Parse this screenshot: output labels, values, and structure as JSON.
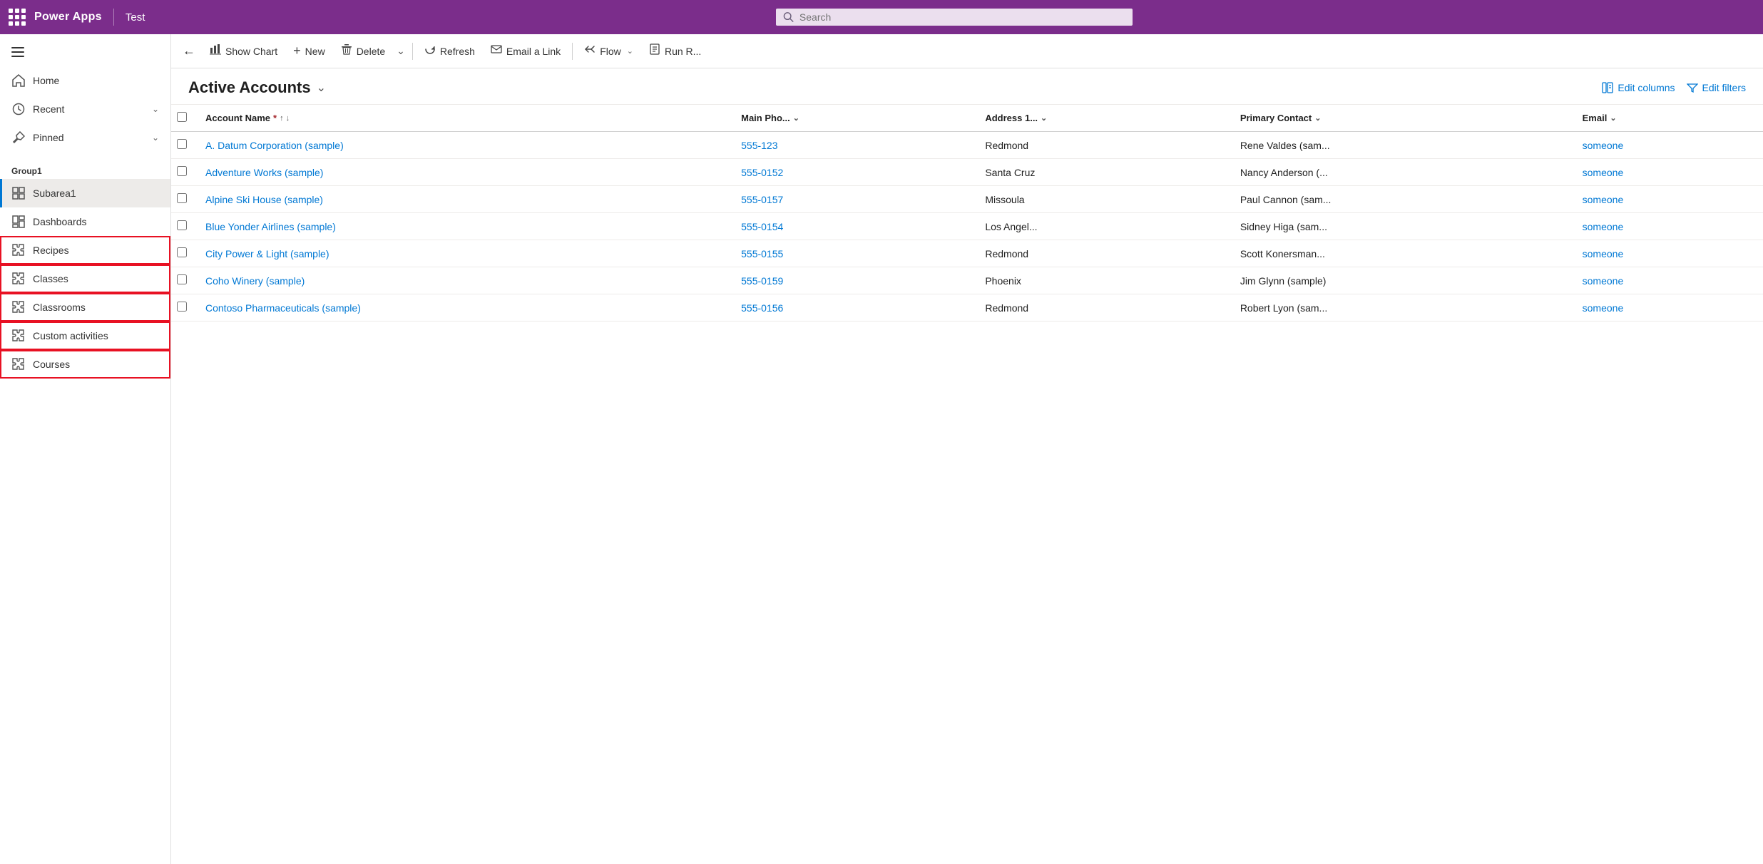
{
  "topNav": {
    "brand": "Power Apps",
    "appName": "Test",
    "searchPlaceholder": "Search"
  },
  "sidebar": {
    "hamburgerLabel": "Menu",
    "items": [
      {
        "id": "home",
        "label": "Home",
        "icon": "home",
        "hasChevron": false
      },
      {
        "id": "recent",
        "label": "Recent",
        "icon": "recent",
        "hasChevron": true
      },
      {
        "id": "pinned",
        "label": "Pinned",
        "icon": "pin",
        "hasChevron": true
      }
    ],
    "groupLabel": "Group1",
    "groupItems": [
      {
        "id": "subarea1",
        "label": "Subarea1",
        "icon": "grid",
        "active": true,
        "highlighted": false
      },
      {
        "id": "dashboards",
        "label": "Dashboards",
        "icon": "dashboard",
        "active": false,
        "highlighted": false
      },
      {
        "id": "recipes",
        "label": "Recipes",
        "icon": "puzzle",
        "active": false,
        "highlighted": true
      },
      {
        "id": "classes",
        "label": "Classes",
        "icon": "puzzle",
        "active": false,
        "highlighted": true
      },
      {
        "id": "classrooms",
        "label": "Classrooms",
        "icon": "puzzle",
        "active": false,
        "highlighted": true
      },
      {
        "id": "custom-activities",
        "label": "Custom activities",
        "icon": "puzzle",
        "active": false,
        "highlighted": true
      },
      {
        "id": "courses",
        "label": "Courses",
        "icon": "puzzle",
        "active": false,
        "highlighted": true
      }
    ]
  },
  "toolbar": {
    "backLabel": "←",
    "showChartLabel": "Show Chart",
    "newLabel": "New",
    "deleteLabel": "Delete",
    "refreshLabel": "Refresh",
    "emailLinkLabel": "Email a Link",
    "flowLabel": "Flow",
    "runReportLabel": "Run R..."
  },
  "pageHeader": {
    "title": "Active Accounts",
    "editColumnsLabel": "Edit columns",
    "editFiltersLabel": "Edit filters"
  },
  "table": {
    "columns": [
      {
        "id": "checkbox",
        "label": ""
      },
      {
        "id": "account-name",
        "label": "Account Name",
        "required": true,
        "sortable": true
      },
      {
        "id": "main-phone",
        "label": "Main Pho...",
        "sortable": true
      },
      {
        "id": "address",
        "label": "Address 1...",
        "sortable": true
      },
      {
        "id": "primary-contact",
        "label": "Primary Contact",
        "sortable": true
      },
      {
        "id": "email",
        "label": "Email",
        "sortable": true
      }
    ],
    "rows": [
      {
        "accountName": "A. Datum Corporation (sample)",
        "mainPhone": "555-123",
        "address": "Redmond",
        "primaryContact": "Rene Valdes (sam...",
        "email": "someone"
      },
      {
        "accountName": "Adventure Works (sample)",
        "mainPhone": "555-0152",
        "address": "Santa Cruz",
        "primaryContact": "Nancy Anderson (...",
        "email": "someone"
      },
      {
        "accountName": "Alpine Ski House (sample)",
        "mainPhone": "555-0157",
        "address": "Missoula",
        "primaryContact": "Paul Cannon (sam...",
        "email": "someone"
      },
      {
        "accountName": "Blue Yonder Airlines (sample)",
        "mainPhone": "555-0154",
        "address": "Los Angel...",
        "primaryContact": "Sidney Higa (sam...",
        "email": "someone"
      },
      {
        "accountName": "City Power & Light (sample)",
        "mainPhone": "555-0155",
        "address": "Redmond",
        "primaryContact": "Scott Konersman...",
        "email": "someone"
      },
      {
        "accountName": "Coho Winery (sample)",
        "mainPhone": "555-0159",
        "address": "Phoenix",
        "primaryContact": "Jim Glynn (sample)",
        "email": "someone"
      },
      {
        "accountName": "Contoso Pharmaceuticals (sample)",
        "mainPhone": "555-0156",
        "address": "Redmond",
        "primaryContact": "Robert Lyon (sam...",
        "email": "someone"
      }
    ]
  }
}
